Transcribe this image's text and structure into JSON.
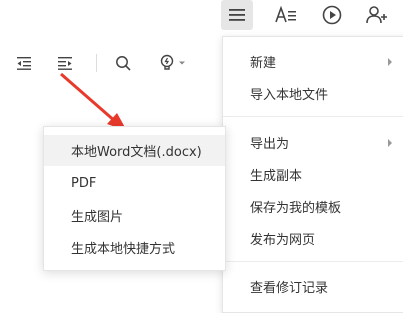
{
  "toolbar": {
    "icons": [
      "menu-icon",
      "text-format-icon",
      "play-icon",
      "add-user-icon"
    ],
    "active": "menu-icon"
  },
  "doc_toolbar": {
    "icons": [
      "outdent-icon",
      "indent-icon",
      "search-icon",
      "lightbulb-icon",
      "chevron-down-icon"
    ]
  },
  "main_menu": {
    "items": [
      {
        "label": "新建",
        "has_submenu": true
      },
      {
        "label": "导入本地文件",
        "has_submenu": false
      },
      {
        "label": "导出为",
        "has_submenu": true
      },
      {
        "label": "生成副本",
        "has_submenu": false
      },
      {
        "label": "保存为我的模板",
        "has_submenu": false
      },
      {
        "label": "发布为网页",
        "has_submenu": false
      },
      {
        "label": "查看修订记录",
        "has_submenu": false
      }
    ]
  },
  "export_submenu": {
    "items": [
      {
        "label": "本地Word文档(.docx)"
      },
      {
        "label": "PDF"
      },
      {
        "label": "生成图片"
      },
      {
        "label": "生成本地快捷方式"
      }
    ],
    "highlighted_index": 0
  },
  "colors": {
    "arrow": "#e8392b",
    "icon": "#444444",
    "menu_hover": "#f2f2f2",
    "active_button": "#e6e6e6"
  }
}
